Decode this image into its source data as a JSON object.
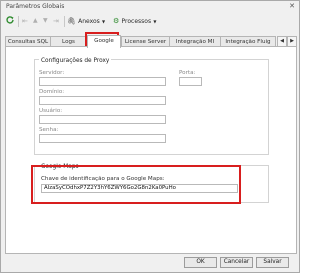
{
  "window": {
    "title": "Parâmetros Globais",
    "close_glyph": "✕"
  },
  "toolbar": {
    "anexos_label": "Anexos",
    "processos_label": "Processos"
  },
  "tabs": [
    {
      "label": "Consultas SQL"
    },
    {
      "label": "Logs"
    },
    {
      "label": "Google"
    },
    {
      "label": "License Server"
    },
    {
      "label": "Integração MI"
    },
    {
      "label": "Integração Fluig"
    }
  ],
  "proxy": {
    "title": "Configurações de Proxy",
    "servidor_label": "Servidor:",
    "porta_label": "Porta:",
    "dominio_label": "Domínio:",
    "usuario_label": "Usuário:",
    "senha_label": "Senha:"
  },
  "maps": {
    "title": "Google Maps",
    "key_label": "Chave de identificação para o Google Maps:",
    "key_value": "AIzaSyCOdhxP7Z2Y3hY6ZWY6Go2G8n2Ka0PuHo"
  },
  "buttons": {
    "ok": "OK",
    "cancel": "Cancelar",
    "save": "Salvar"
  },
  "colors": {
    "highlight": "#d81e1e",
    "accent_green": "#2e8b2e"
  }
}
